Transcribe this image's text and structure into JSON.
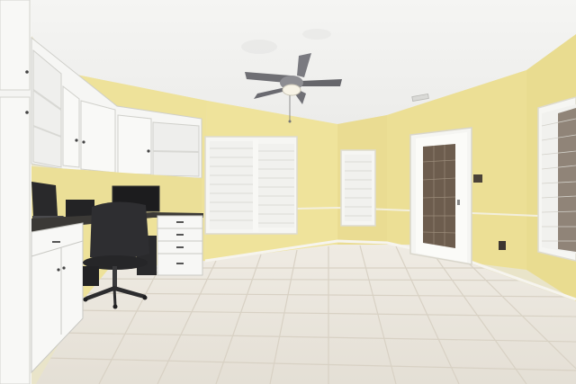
{
  "scene": {
    "type": "photo",
    "room": "home office",
    "objects": [
      "ceiling-fan-icon",
      "window-icon",
      "door-icon",
      "office-chair-icon",
      "computer-monitor-icon",
      "laptop-icon",
      "cabinet-icon",
      "tile-floor"
    ]
  },
  "colors": {
    "wall": "#eee29a",
    "wall_shadow": "#e4d488",
    "ceiling": "#f3f3f1",
    "floor": "#ece8e0",
    "grout": "#d9d3c8",
    "cabinet": "#f7f7f5",
    "cabinet_edge": "#c9c9c4",
    "countertop": "#3b3936",
    "chair": "#2e2e31",
    "blind": "#f1f1ee",
    "door_screen": "#6d5d4e",
    "fan_blade": "#6f6f74"
  }
}
